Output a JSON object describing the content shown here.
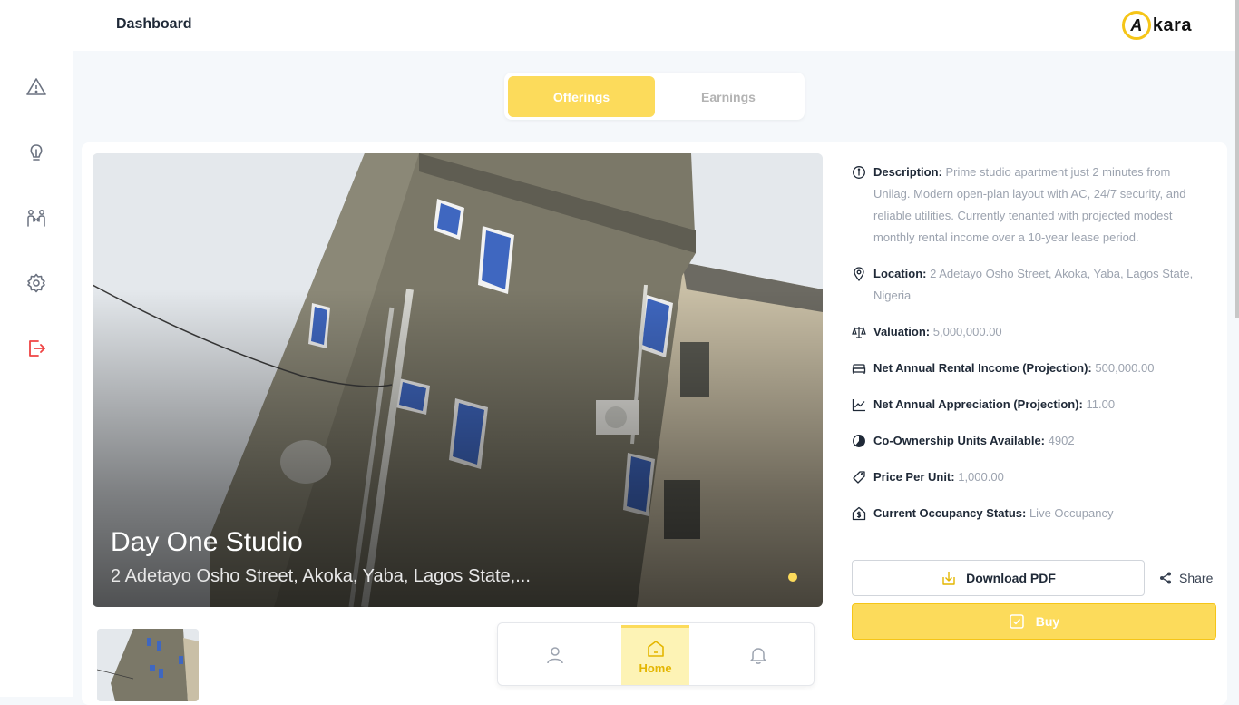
{
  "header": {
    "title": "Dashboard",
    "logo_text": "kara",
    "logo_mark": "A"
  },
  "sidebar": {
    "items": [
      {
        "icon": "warning-icon"
      },
      {
        "icon": "lightbulb-icon"
      },
      {
        "icon": "users-exchange-icon"
      },
      {
        "icon": "gear-icon"
      },
      {
        "icon": "logout-icon",
        "color": "#ef4444"
      }
    ]
  },
  "tabs": [
    {
      "label": "Offerings",
      "active": true
    },
    {
      "label": "Earnings",
      "active": false
    }
  ],
  "hero": {
    "title": "Day One Studio",
    "address": "2 Adetayo Osho Street, Akoka, Yaba, Lagos State,..."
  },
  "details": {
    "description_label": "Description:",
    "description_value": "Prime studio apartment just 2 minutes from Unilag. Modern open-plan layout with AC, 24/7 security, and reliable utilities. Currently tenanted with projected modest monthly rental income over a 10-year lease period.",
    "location_label": "Location:",
    "location_value": "2 Adetayo Osho Street, Akoka, Yaba, Lagos State, Nigeria",
    "valuation_label": "Valuation:",
    "valuation_value": "5,000,000.00",
    "rental_label": "Net Annual Rental Income (Projection):",
    "rental_value": "500,000.00",
    "appreciation_label": "Net Annual Appreciation (Projection):",
    "appreciation_value": "11.00",
    "units_label": "Co-Ownership Units Available:",
    "units_value": "4902",
    "price_label": "Price Per Unit:",
    "price_value": "1,000.00",
    "occupancy_label": "Current Occupancy Status:",
    "occupancy_value": "Live Occupancy"
  },
  "actions": {
    "download_label": "Download PDF",
    "share_label": "Share",
    "buy_label": "Buy"
  },
  "bottom_nav": {
    "home_label": "Home"
  },
  "colors": {
    "accent": "#fcdb5b",
    "danger": "#ef4444",
    "muted_text": "#9ca3af"
  }
}
